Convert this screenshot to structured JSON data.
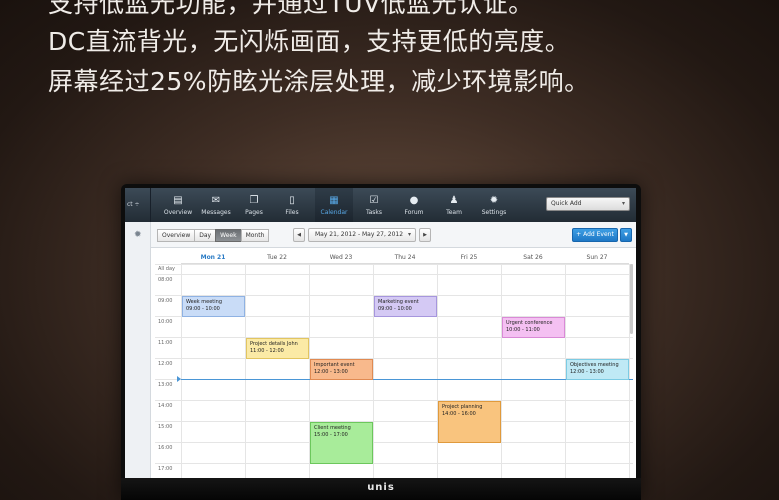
{
  "headline": {
    "line0": "支持低蓝光功能，并通过TÜV低蓝光认证。",
    "line1": "DC直流背光，无闪烁画面，支持更低的亮度。",
    "line2": "屏幕经过25%防眩光涂层处理，减少环境影响。"
  },
  "monitor": {
    "brand": "unis"
  },
  "app": {
    "project_label": "ct ÷",
    "nav": [
      {
        "label": "Overview",
        "icon": "overview-icon",
        "glyph": "▤"
      },
      {
        "label": "Messages",
        "icon": "envelope-icon",
        "glyph": "✉"
      },
      {
        "label": "Pages",
        "icon": "pages-icon",
        "glyph": "❐"
      },
      {
        "label": "Files",
        "icon": "file-icon",
        "glyph": "▯"
      },
      {
        "label": "Calendar",
        "icon": "calendar-icon",
        "glyph": "▦"
      },
      {
        "label": "Tasks",
        "icon": "checkbox-icon",
        "glyph": "☑"
      },
      {
        "label": "Forum",
        "icon": "chat-bubble-icon",
        "glyph": "●"
      },
      {
        "label": "Team",
        "icon": "team-icon",
        "glyph": "♟"
      },
      {
        "label": "Settings",
        "icon": "gear-icon",
        "glyph": "✹"
      }
    ],
    "active_nav": "Calendar",
    "quick_add": "Quick Add"
  },
  "calendar": {
    "views": [
      "Overview",
      "Day",
      "Week",
      "Month"
    ],
    "active_view": "Week",
    "prev": "◀",
    "next": "▶",
    "date_range": "May 21, 2012 - May 27, 2012",
    "add_event": "+ Add Event",
    "days": [
      "Mon 21",
      "Tue 22",
      "Wed 23",
      "Thu 24",
      "Fri 25",
      "Sat 26",
      "Sun 27"
    ],
    "today": "Mon 21",
    "all_day": "All day",
    "hours": [
      "08:00",
      "09:00",
      "10:00",
      "11:00",
      "12:00",
      "13:00",
      "14:00",
      "15:00",
      "16:00",
      "17:00"
    ],
    "events": [
      {
        "title": "Week meeting",
        "time": "09:00 - 10:00",
        "day": 0,
        "start": 9,
        "end": 10,
        "bg": "#c9dcf7",
        "border": "#8fb2e3"
      },
      {
        "title": "Project details John",
        "time": "11:00 - 12:00",
        "day": 1,
        "start": 11,
        "end": 12,
        "bg": "#fbeaa6",
        "border": "#e2c561"
      },
      {
        "title": "Important event",
        "time": "12:00 - 13:00",
        "day": 2,
        "start": 12,
        "end": 13,
        "bg": "#f8b98c",
        "border": "#e08a52"
      },
      {
        "title": "Client meeting",
        "time": "15:00 - 17:00",
        "day": 2,
        "start": 15,
        "end": 17,
        "bg": "#a8ec9a",
        "border": "#6cc75c"
      },
      {
        "title": "Marketing event",
        "time": "09:00 - 10:00",
        "day": 3,
        "start": 9,
        "end": 10,
        "bg": "#d4c9f4",
        "border": "#a696dd"
      },
      {
        "title": "Project planning",
        "time": "14:00 - 16:00",
        "day": 4,
        "start": 14,
        "end": 16,
        "bg": "#f9c47e",
        "border": "#e09a3c"
      },
      {
        "title": "Urgent conference",
        "time": "10:00 - 11:00",
        "day": 5,
        "start": 10,
        "end": 11,
        "bg": "#f4c0f2",
        "border": "#d98ad6"
      },
      {
        "title": "Objectives meeting",
        "time": "12:00 - 13:00",
        "day": 6,
        "start": 12,
        "end": 13,
        "bg": "#bfe9f5",
        "border": "#7ccbe3"
      }
    ]
  }
}
